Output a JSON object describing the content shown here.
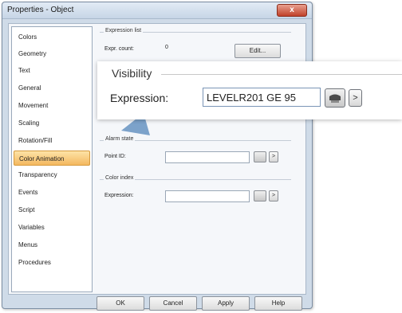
{
  "window": {
    "title": "Properties - Object",
    "close_label": "x"
  },
  "sidebar": {
    "items": [
      {
        "label": "Colors"
      },
      {
        "label": "Geometry"
      },
      {
        "label": "Text"
      },
      {
        "label": "General"
      },
      {
        "label": "Movement"
      },
      {
        "label": "Scaling"
      },
      {
        "label": "Rotation/Fill"
      },
      {
        "label": "Color Animation",
        "active": true
      },
      {
        "label": "Transparency"
      },
      {
        "label": "Events"
      },
      {
        "label": "Script"
      },
      {
        "label": "Variables"
      },
      {
        "label": "Menus"
      },
      {
        "label": "Procedures"
      }
    ]
  },
  "expression_list": {
    "group_label": "Expression list",
    "count_label": "Expr. count:",
    "count_value": "0",
    "edit_button": "Edit..."
  },
  "alarm_state": {
    "group_label": "Alarm state",
    "point_label": "Point ID:",
    "point_value": ""
  },
  "color_index": {
    "group_label": "Color index",
    "expression_label": "Expression:",
    "expression_value": ""
  },
  "footer": {
    "ok": "OK",
    "cancel": "Cancel",
    "apply": "Apply",
    "help": "Help"
  },
  "zoom": {
    "group_label": "Visibility",
    "expression_label": "Expression:",
    "expression_value": "LEVELR201 GE 95",
    "arrow_glyph": ">"
  },
  "colors": {
    "active_item": "#f4b860",
    "close_button": "#c0412a",
    "pointer": "#6f98c4"
  }
}
